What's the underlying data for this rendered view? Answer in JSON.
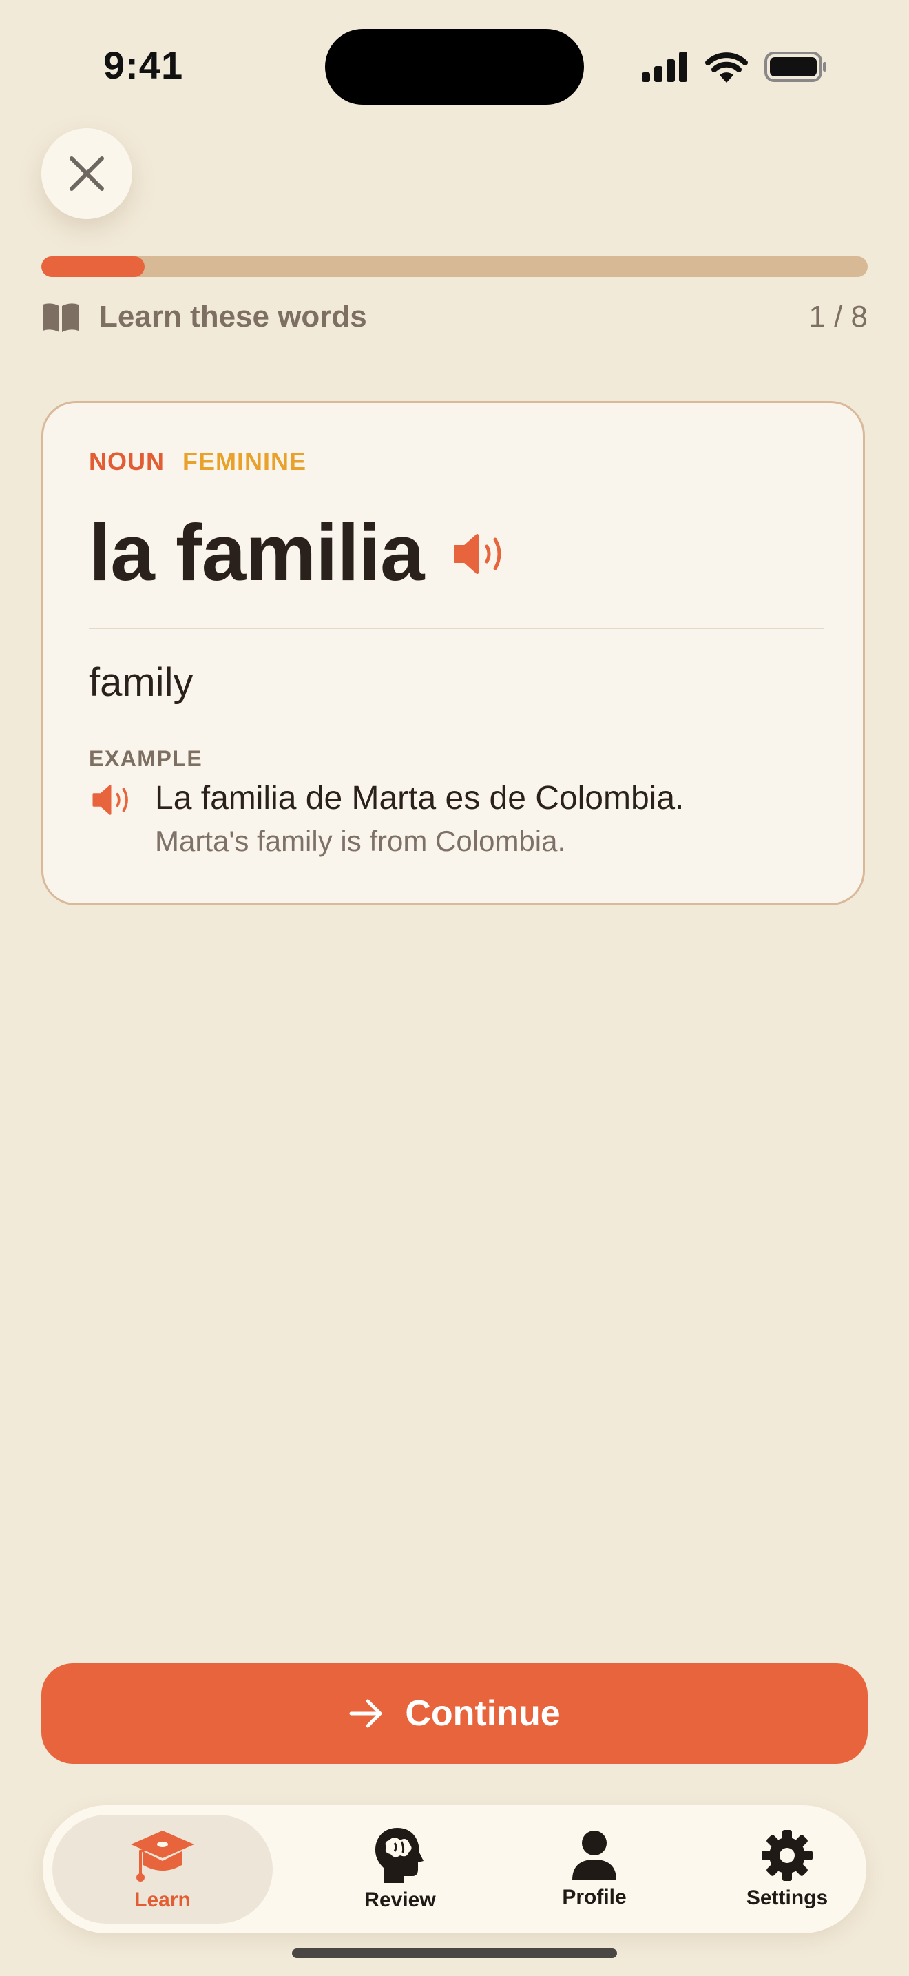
{
  "status": {
    "time": "9:41"
  },
  "progress": {
    "value": 0.125,
    "label": "Learn these words",
    "count": "1 / 8"
  },
  "card": {
    "tags": {
      "part_of_speech": "NOUN",
      "gender": "FEMININE"
    },
    "word": "la familia",
    "translation": "family",
    "example": {
      "label": "EXAMPLE",
      "sentence": "La familia de Marta es de Colombia.",
      "translation": "Marta's family is from Colombia."
    }
  },
  "continue_label": "Continue",
  "tabs": [
    {
      "label": "Learn",
      "icon": "graduation-cap-icon",
      "active": true
    },
    {
      "label": "Review",
      "icon": "brain-head-icon",
      "active": false
    },
    {
      "label": "Profile",
      "icon": "person-icon",
      "active": false
    },
    {
      "label": "Settings",
      "icon": "gear-icon",
      "active": false
    }
  ],
  "colors": {
    "accent": "#e8643c",
    "tag_noun": "#e35d34",
    "tag_feminine": "#e8a22a",
    "background": "#f2ead9",
    "card": "#faf5ec"
  }
}
